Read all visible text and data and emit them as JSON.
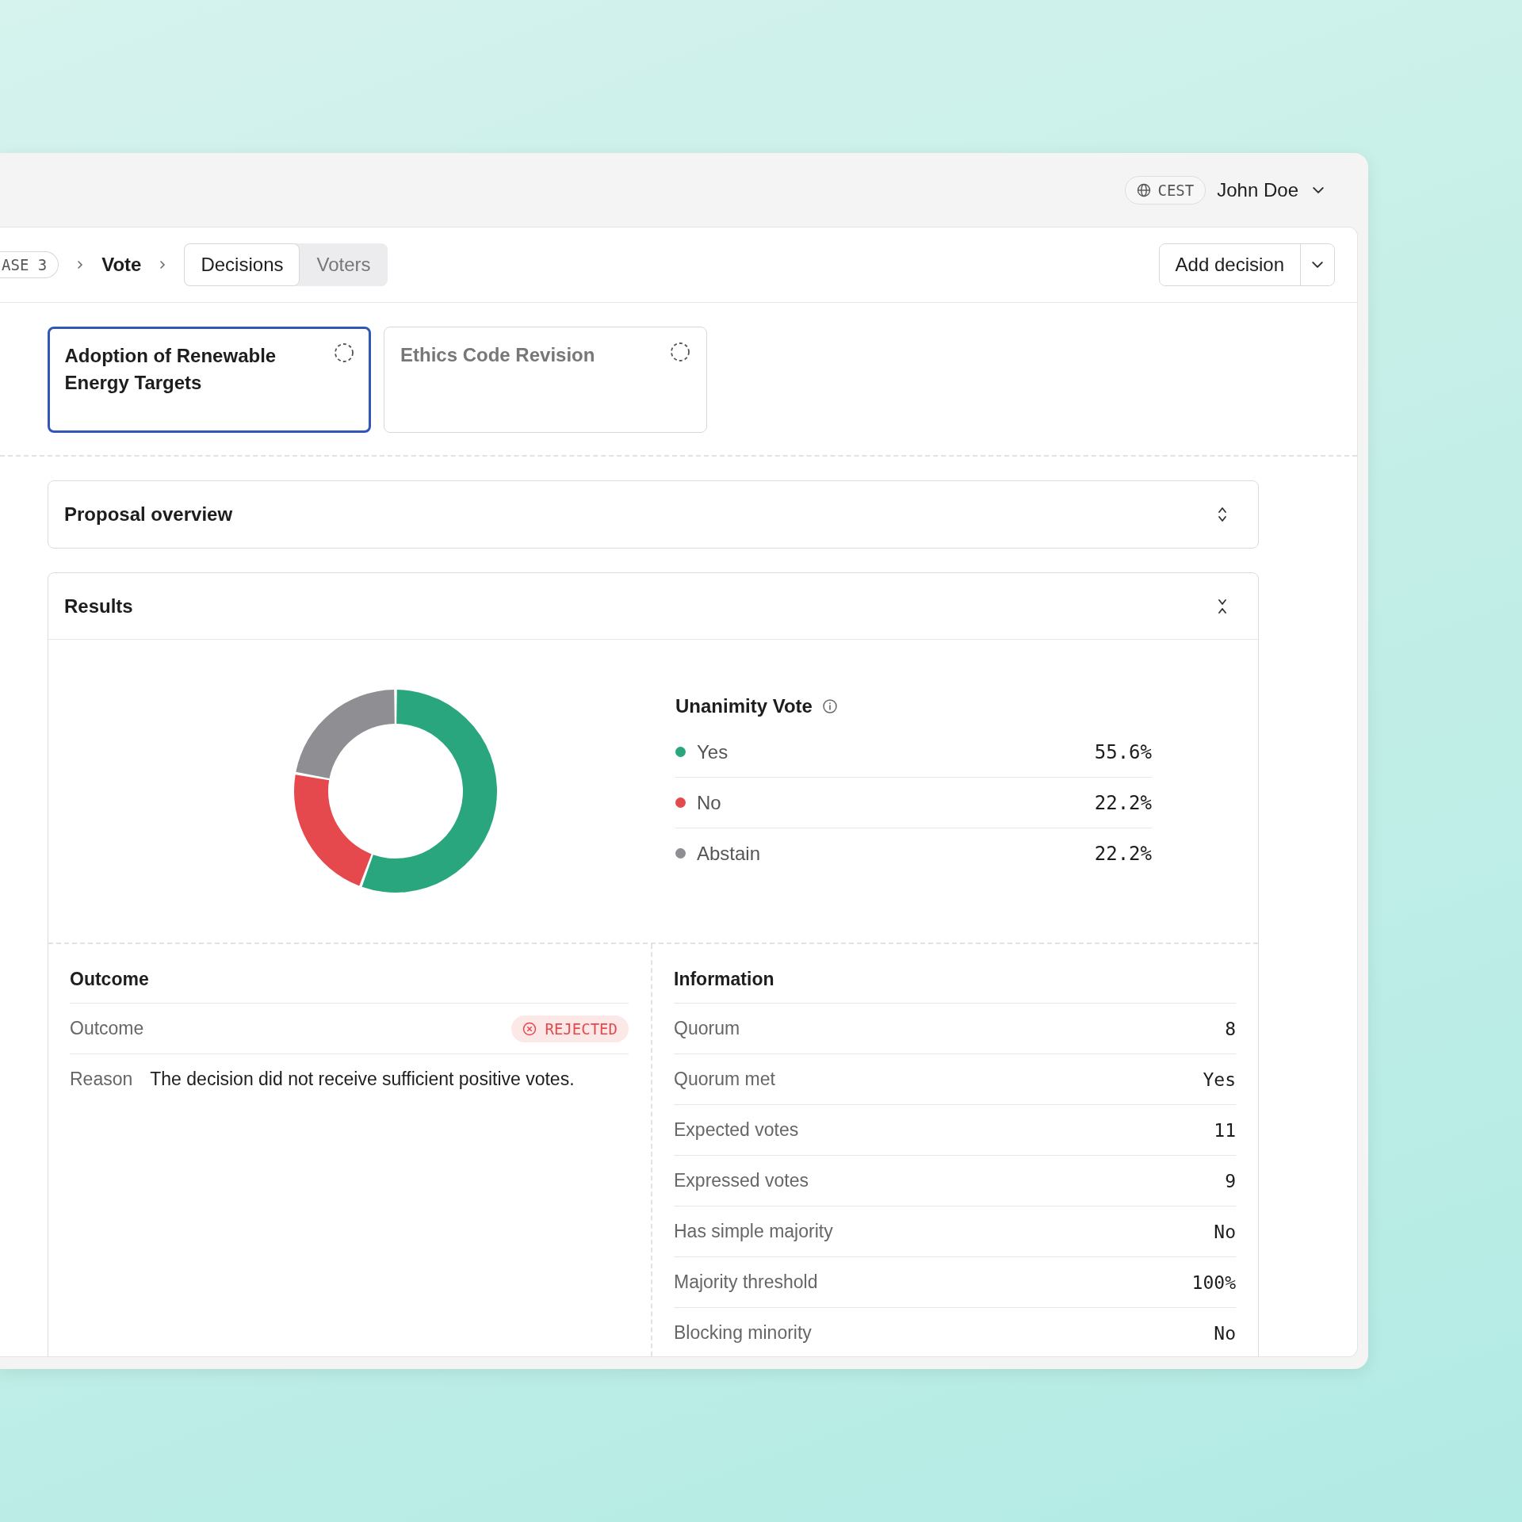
{
  "header": {
    "timezone": "CEST",
    "user": "John Doe"
  },
  "breadcrumb": {
    "phase": "ASE 3",
    "current": "Vote"
  },
  "tabs": [
    {
      "label": "Decisions",
      "selected": true
    },
    {
      "label": "Voters",
      "selected": false
    }
  ],
  "add_button": {
    "label": "Add decision"
  },
  "decisions": [
    {
      "title": "Adoption of Renewable Energy Targets",
      "selected": true
    },
    {
      "title": "Ethics Code Revision",
      "selected": false
    }
  ],
  "sections": [
    {
      "title": "Proposal overview",
      "expanded": false
    },
    {
      "title": "Results",
      "expanded": true
    }
  ],
  "results": {
    "chart_data": {
      "type": "donut",
      "categories": [
        "Yes",
        "No",
        "Abstain"
      ],
      "values": [
        55.6,
        22.2,
        22.2
      ]
    },
    "title": "Unanimity Vote",
    "legend": [
      {
        "value": "55.6%",
        "color": "#2aa67e"
      },
      {
        "value": "22.2%",
        "color": "#e5484d"
      },
      {
        "value": "22.2%",
        "color": "#8e8e93"
      }
    ]
  },
  "outcome": {
    "title": "Outcome",
    "outcome_label": "Outcome",
    "status": {
      "label": "REJECTED",
      "kind": "danger"
    },
    "reason_label": "Reason",
    "reason": "The decision did not receive sufficient positive votes."
  },
  "information": {
    "title": "Information",
    "rows": [
      {
        "label": "Quorum",
        "value": "8"
      },
      {
        "label": "Quorum met",
        "value": "Yes"
      },
      {
        "label": "Expected votes",
        "value": "11"
      },
      {
        "label": "Expressed votes",
        "value": "9"
      },
      {
        "label": "Has simple majority",
        "value": "No"
      },
      {
        "label": "Majority threshold",
        "value": "100%"
      },
      {
        "label": "Blocking minority",
        "value": "No"
      }
    ]
  }
}
